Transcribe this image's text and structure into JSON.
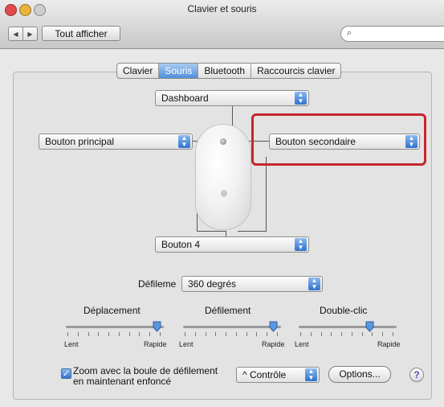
{
  "window": {
    "title": "Clavier et souris"
  },
  "toolbar": {
    "show_all": "Tout afficher",
    "back_icon": "◀",
    "forward_icon": "▶",
    "search_icon": "⌕"
  },
  "colors": {
    "close": "#e24b4b",
    "minimize": "#e8b43a",
    "zoom": "#c6c6c6",
    "accent": "#3b7fd7",
    "highlight": "#c6262e"
  },
  "tabs": [
    {
      "label": "Clavier",
      "active": false
    },
    {
      "label": "Souris",
      "active": true
    },
    {
      "label": "Bluetooth",
      "active": false
    },
    {
      "label": "Raccourcis clavier",
      "active": false
    }
  ],
  "mouse": {
    "top_button": "Dashboard",
    "left_button": "Bouton principal",
    "right_button": "Bouton secondaire",
    "bottom_button": "Bouton 4"
  },
  "scroll": {
    "label": "Défileme",
    "value": "360 degrés"
  },
  "sliders": [
    {
      "title": "Déplacement",
      "min_label": "Lent",
      "max_label": "Rapide",
      "level": 0.95
    },
    {
      "title": "Défilement",
      "min_label": "Lent",
      "max_label": "Rapide",
      "level": 0.92
    },
    {
      "title": "Double-clic",
      "min_label": "Lent",
      "max_label": "Rapide",
      "level": 0.72
    }
  ],
  "zoom": {
    "checked": true,
    "check_mark": "✓",
    "line1": "Zoom avec la boule de défilement",
    "line2": "en maintenant enfoncé",
    "modifier": "^ Contrôle",
    "options_button": "Options...",
    "help": "?"
  }
}
